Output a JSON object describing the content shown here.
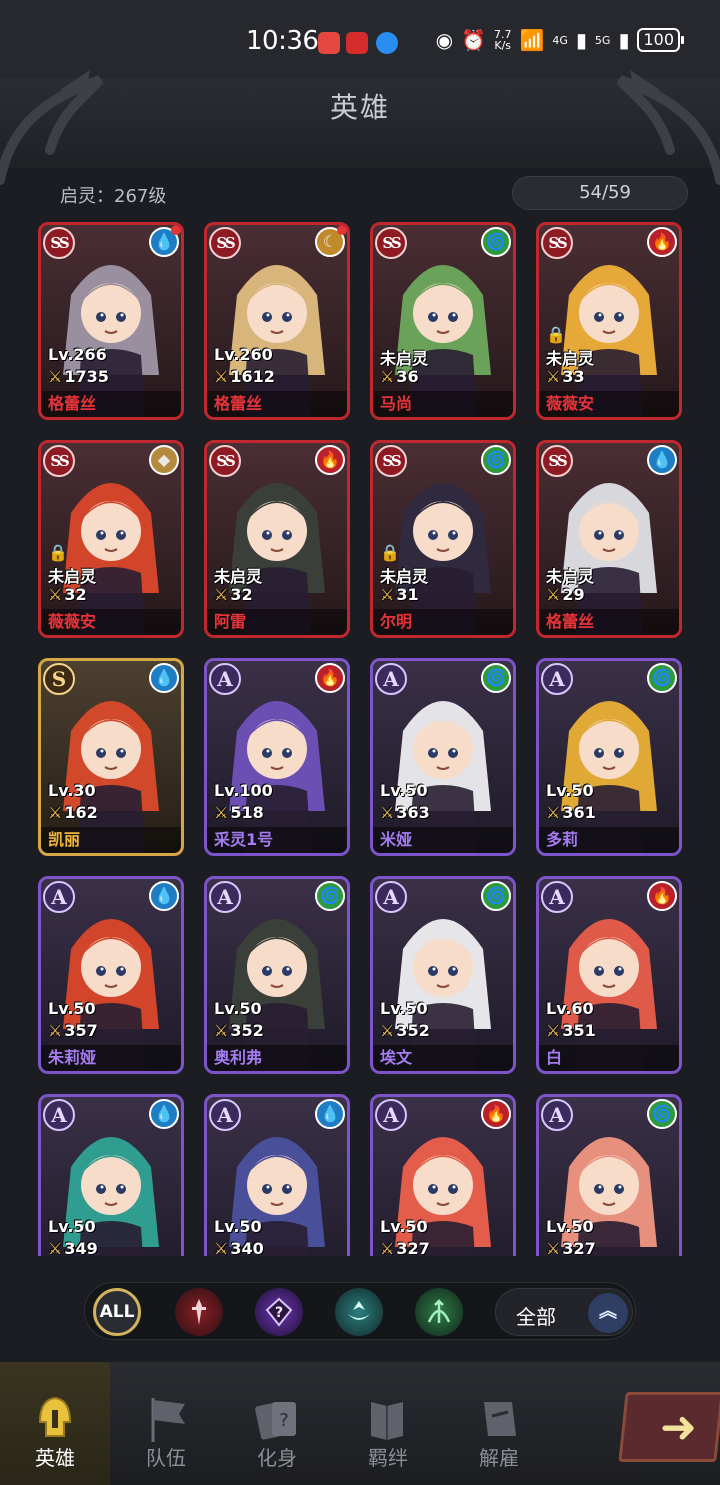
{
  "status_bar": {
    "time": "10:36",
    "net_speed_top": "7.7",
    "net_speed_bottom": "K/s",
    "wifi_badge": "6",
    "sig1": "4G",
    "sig2": "5G",
    "battery": "100"
  },
  "page": {
    "title": "英雄"
  },
  "summary": {
    "awaken_label": "启灵：267级",
    "hero_count": "54/59"
  },
  "heroes": [
    {
      "rank": "SS",
      "element": "water",
      "red_dot": true,
      "locked": false,
      "level": "Lv.266",
      "power": "1735",
      "name": "格蕾丝"
    },
    {
      "rank": "SS",
      "element": "moon",
      "red_dot": true,
      "locked": false,
      "level": "Lv.260",
      "power": "1612",
      "name": "格蕾丝"
    },
    {
      "rank": "SS",
      "element": "wind",
      "red_dot": false,
      "locked": false,
      "level": "未启灵",
      "power": "36",
      "name": "马尚"
    },
    {
      "rank": "SS",
      "element": "fire",
      "red_dot": false,
      "locked": true,
      "level": "未启灵",
      "power": "33",
      "name": "薇薇安"
    },
    {
      "rank": "SS",
      "element": "earth",
      "red_dot": false,
      "locked": true,
      "level": "未启灵",
      "power": "32",
      "name": "薇薇安"
    },
    {
      "rank": "SS",
      "element": "fire",
      "red_dot": false,
      "locked": false,
      "level": "未启灵",
      "power": "32",
      "name": "阿雷"
    },
    {
      "rank": "SS",
      "element": "wind",
      "red_dot": false,
      "locked": true,
      "level": "未启灵",
      "power": "31",
      "name": "尔明"
    },
    {
      "rank": "SS",
      "element": "water",
      "red_dot": false,
      "locked": false,
      "level": "未启灵",
      "power": "29",
      "name": "格蕾丝"
    },
    {
      "rank": "S",
      "element": "water",
      "red_dot": false,
      "locked": false,
      "level": "Lv.30",
      "power": "162",
      "name": "凯丽"
    },
    {
      "rank": "A",
      "element": "fire",
      "red_dot": false,
      "locked": false,
      "level": "Lv.100",
      "power": "518",
      "name": "采灵1号"
    },
    {
      "rank": "A",
      "element": "wind",
      "red_dot": false,
      "locked": false,
      "level": "Lv.50",
      "power": "363",
      "name": "米娅"
    },
    {
      "rank": "A",
      "element": "wind",
      "red_dot": false,
      "locked": false,
      "level": "Lv.50",
      "power": "361",
      "name": "多莉"
    },
    {
      "rank": "A",
      "element": "water",
      "red_dot": false,
      "locked": false,
      "level": "Lv.50",
      "power": "357",
      "name": "朱莉娅"
    },
    {
      "rank": "A",
      "element": "wind",
      "red_dot": false,
      "locked": false,
      "level": "Lv.50",
      "power": "352",
      "name": "奥利弗"
    },
    {
      "rank": "A",
      "element": "wind",
      "red_dot": false,
      "locked": false,
      "level": "Lv.50",
      "power": "352",
      "name": "埃文"
    },
    {
      "rank": "A",
      "element": "fire",
      "red_dot": false,
      "locked": false,
      "level": "Lv.60",
      "power": "351",
      "name": "白"
    },
    {
      "rank": "A",
      "element": "water",
      "red_dot": false,
      "locked": false,
      "level": "Lv.50",
      "power": "349",
      "name": ""
    },
    {
      "rank": "A",
      "element": "water",
      "red_dot": false,
      "locked": false,
      "level": "Lv.50",
      "power": "340",
      "name": ""
    },
    {
      "rank": "A",
      "element": "fire",
      "red_dot": false,
      "locked": false,
      "level": "Lv.50",
      "power": "327",
      "name": ""
    },
    {
      "rank": "A",
      "element": "wind",
      "red_dot": false,
      "locked": false,
      "level": "Lv.50",
      "power": "327",
      "name": ""
    }
  ],
  "rank_labels": {
    "SS": "SS",
    "S": "S",
    "A": "A"
  },
  "element_glyphs": {
    "water": "💧",
    "fire": "🔥",
    "wind": "🌀",
    "moon": "☾",
    "earth": "◆"
  },
  "element_colors": {
    "water": "#1f7ec3",
    "fire": "#b8202a",
    "wind": "#2d9a3e",
    "moon": "#c08a2b",
    "earth": "#b58a3c"
  },
  "hair_colors": [
    "#9a8f9e",
    "#d8b57a",
    "#6aa25a",
    "#e7a83a",
    "#d2452a",
    "#3b3f3a",
    "#2f2a3f",
    "#d7d7dc",
    "#d2482a",
    "#6b4fb3",
    "#e3e3e8",
    "#e0a936",
    "#d2452a",
    "#3b3f3a",
    "#e6e6ea",
    "#e05a4a",
    "#2f9d8f",
    "#4a4f9a",
    "#e45c4a",
    "#e8907e"
  ],
  "filters": {
    "all_label": "ALL",
    "class_icons": [
      "warrior-class-icon",
      "mystic-class-icon",
      "support-class-icon",
      "ranger-class-icon"
    ],
    "dropdown_label": "全部",
    "dropdown_chevron": "︽"
  },
  "nav": {
    "items": [
      {
        "label": "英雄",
        "icon": "helmet-icon",
        "active": true
      },
      {
        "label": "队伍",
        "icon": "banner-icon",
        "active": false
      },
      {
        "label": "化身",
        "icon": "cards-icon",
        "active": false
      },
      {
        "label": "羁绊",
        "icon": "book-icon",
        "active": false
      },
      {
        "label": "解雇",
        "icon": "scroll-icon",
        "active": false
      }
    ],
    "next_arrow": "➜"
  },
  "accent": {
    "gold": "#d4b35c",
    "ss_border": "#c0282e",
    "a_border": "#7d54c9",
    "s_border": "#d6a845"
  }
}
